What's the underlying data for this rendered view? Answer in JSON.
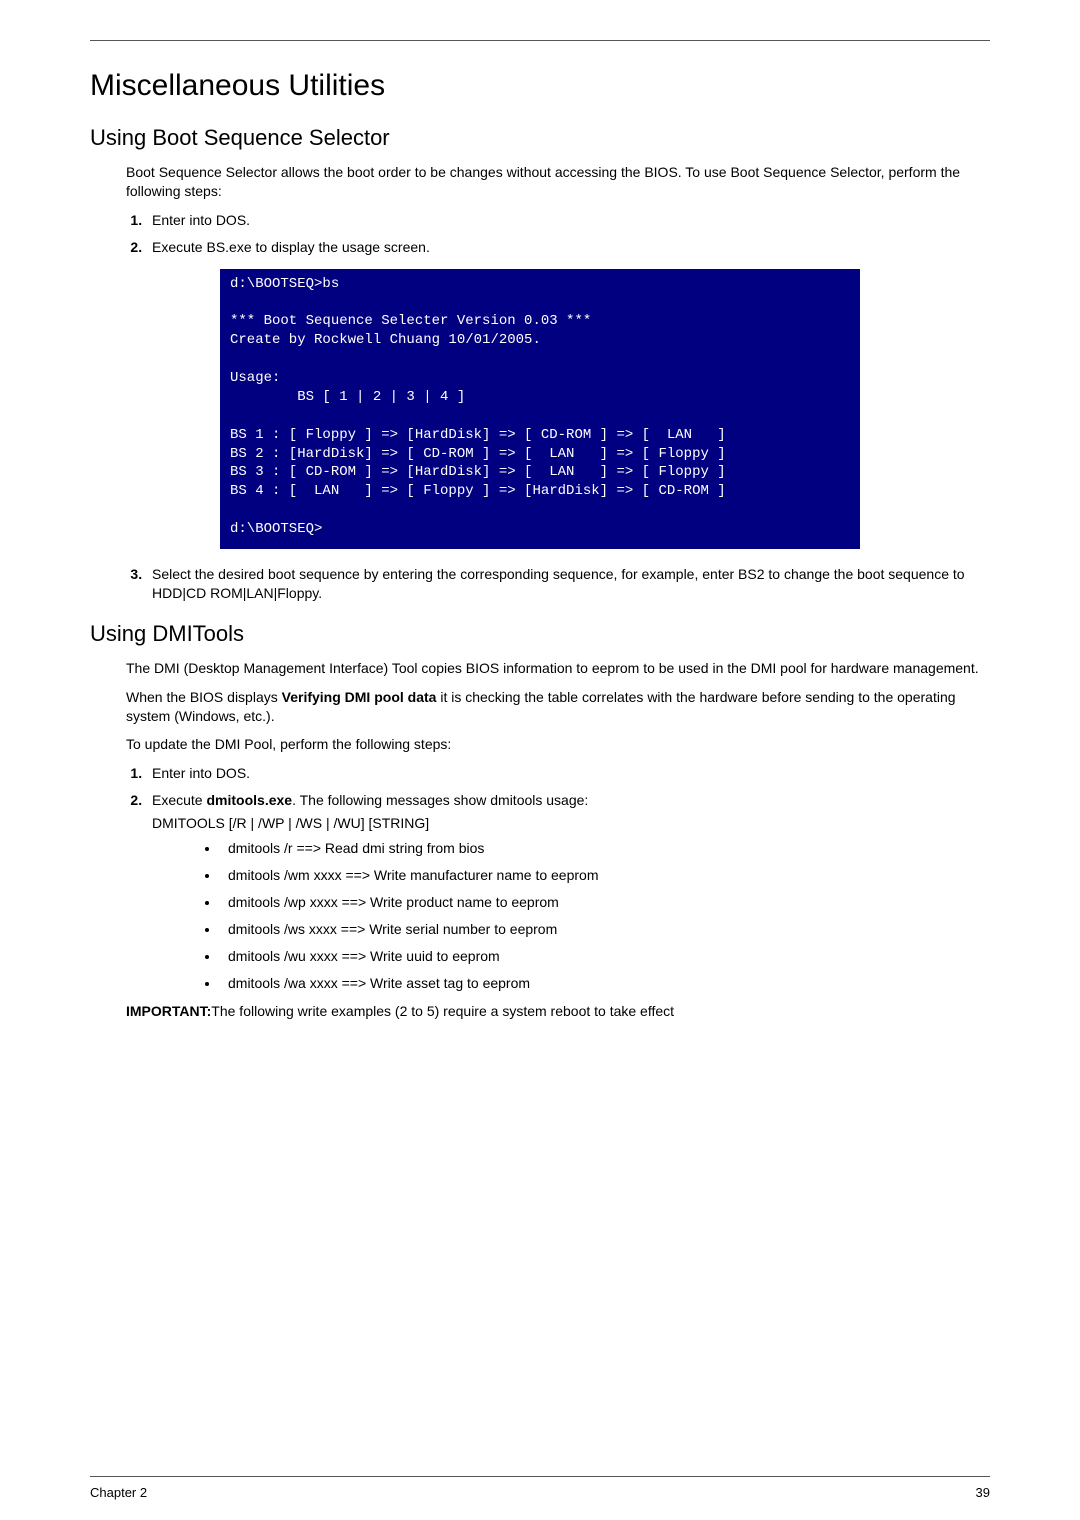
{
  "title": "Miscellaneous Utilities",
  "section1": {
    "heading": "Using Boot Sequence Selector",
    "intro": "Boot Sequence Selector allows the boot order to be changes without accessing the BIOS. To use Boot Sequence Selector, perform the following steps:",
    "step1": "Enter into DOS.",
    "step2": "Execute BS.exe to display the usage screen.",
    "step3": "Select the desired boot sequence by entering the corresponding sequence, for example, enter BS2 to change the boot sequence to HDD|CD ROM|LAN|Floppy.",
    "terminal": "d:\\BOOTSEQ>bs\n\n*** Boot Sequence Selecter Version 0.03 ***\nCreate by Rockwell Chuang 10/01/2005.\n\nUsage:\n        BS [ 1 | 2 | 3 | 4 ]\n\nBS 1 : [ Floppy ] => [HardDisk] => [ CD-ROM ] => [  LAN   ]\nBS 2 : [HardDisk] => [ CD-ROM ] => [  LAN   ] => [ Floppy ]\nBS 3 : [ CD-ROM ] => [HardDisk] => [  LAN   ] => [ Floppy ]\nBS 4 : [  LAN   ] => [ Floppy ] => [HardDisk] => [ CD-ROM ]\n\nd:\\BOOTSEQ>"
  },
  "section2": {
    "heading": "Using DMITools",
    "para1": "The DMI (Desktop Management Interface) Tool copies BIOS information to eeprom to be used in the DMI pool for hardware management.",
    "para2_pre": "When the BIOS displays ",
    "para2_bold": "Verifying DMI pool data",
    "para2_post": " it is checking the table correlates with the hardware before sending to the operating system (Windows, etc.).",
    "para3": "To update the DMI Pool, perform the following steps:",
    "step1": "Enter into DOS.",
    "step2_pre": "Execute ",
    "step2_bold": "dmitools.exe",
    "step2_post": ". The following messages show dmitools usage:",
    "step2_line2": "DMITOOLS [/R | /WP | /WS | /WU] [STRING]",
    "bullets": {
      "b1": "dmitools /r ==> Read dmi string from bios",
      "b2": "dmitools /wm xxxx ==> Write manufacturer name to eeprom",
      "b3": "dmitools /wp xxxx ==> Write product name to eeprom",
      "b4": "dmitools /ws xxxx ==> Write serial number to eeprom",
      "b5": "dmitools /wu xxxx ==> Write uuid to eeprom",
      "b6": "dmitools /wa xxxx ==> Write asset tag to eeprom"
    },
    "important_label": "IMPORTANT:",
    "important_text": "The following write examples (2 to 5) require a system reboot to take effect"
  },
  "footer": {
    "left": "Chapter 2",
    "right": "39"
  }
}
